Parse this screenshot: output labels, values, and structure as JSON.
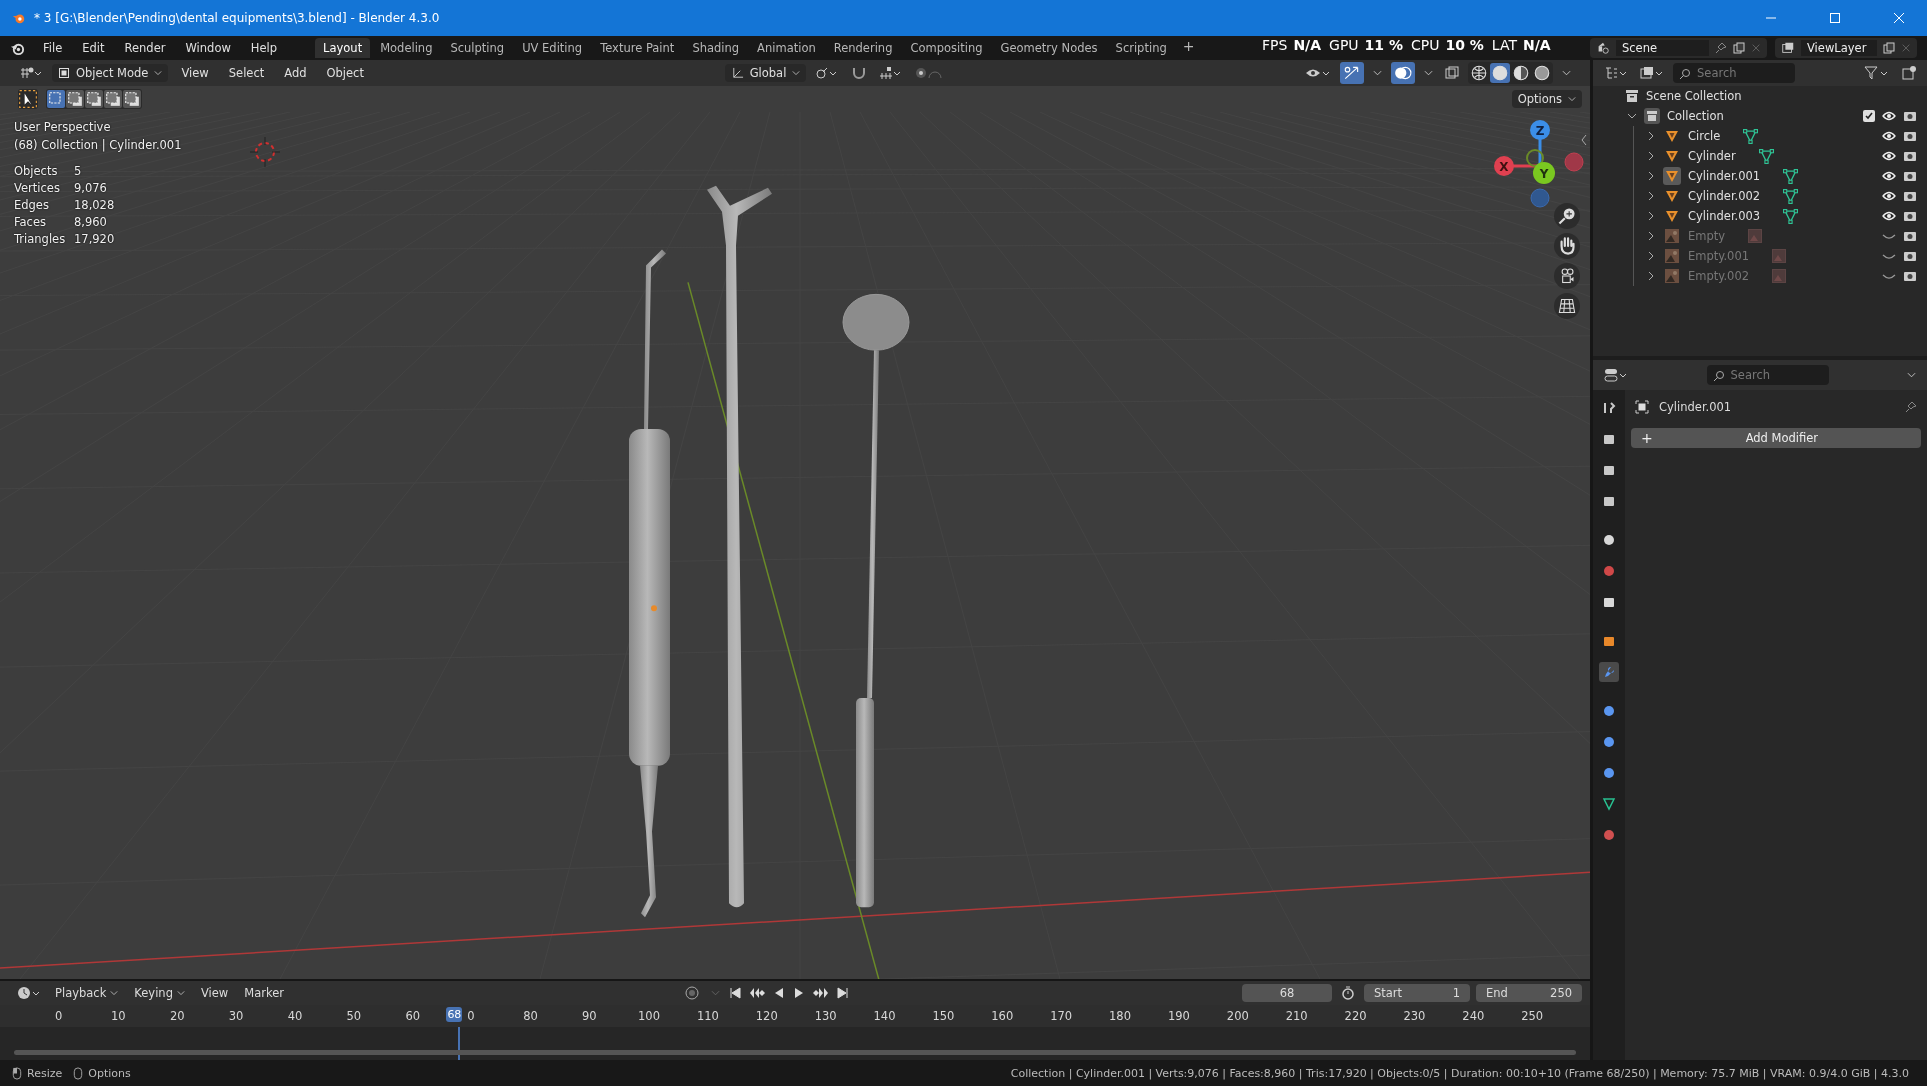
{
  "window": {
    "title": "* 3 [G:\\Blender\\Pending\\dental equipments\\3.blend] - Blender 4.3.0"
  },
  "menu": [
    "File",
    "Edit",
    "Render",
    "Window",
    "Help"
  ],
  "workspaces": [
    {
      "label": "Layout",
      "selected": true
    },
    {
      "label": "Modeling",
      "selected": false
    },
    {
      "label": "Sculpting",
      "selected": false
    },
    {
      "label": "UV Editing",
      "selected": false
    },
    {
      "label": "Texture Paint",
      "selected": false
    },
    {
      "label": "Shading",
      "selected": false
    },
    {
      "label": "Animation",
      "selected": false
    },
    {
      "label": "Rendering",
      "selected": false
    },
    {
      "label": "Compositing",
      "selected": false
    },
    {
      "label": "Geometry Nodes",
      "selected": false
    },
    {
      "label": "Scripting",
      "selected": false
    }
  ],
  "add_workspace": "+",
  "perf": [
    {
      "label": "FPS",
      "value": "N/A"
    },
    {
      "label": "GPU",
      "value": "11 %"
    },
    {
      "label": "CPU",
      "value": "10 %"
    },
    {
      "label": "LAT",
      "value": "N/A"
    }
  ],
  "scene": "Scene",
  "view_layer": "ViewLayer",
  "viewport": {
    "mode": "Object Mode",
    "menus": [
      "View",
      "Select",
      "Add",
      "Object"
    ],
    "orientation": "Global",
    "select_modes": [
      {
        "selected": true
      },
      {
        "selected": false
      },
      {
        "selected": false
      },
      {
        "selected": false
      },
      {
        "selected": false
      }
    ],
    "shading": [
      {
        "kind": "wireframe",
        "selected": false
      },
      {
        "kind": "solid",
        "selected": true
      },
      {
        "kind": "material",
        "selected": false
      },
      {
        "kind": "rendered",
        "selected": false
      }
    ],
    "options": "Options",
    "perspective": "User Perspective",
    "context": "(68) Collection | Cylinder.001",
    "stats": [
      {
        "label": "Objects",
        "value": "5"
      },
      {
        "label": "Vertices",
        "value": "9,076"
      },
      {
        "label": "Edges",
        "value": "18,028"
      },
      {
        "label": "Faces",
        "value": "8,960"
      },
      {
        "label": "Triangles",
        "value": "17,920"
      }
    ],
    "gizmo": {
      "x": "X",
      "y": "Y",
      "z": "Z"
    }
  },
  "outliner": {
    "search": {
      "placeholder": "Search"
    },
    "root": "Scene Collection",
    "collections": [
      {
        "name": "Collection",
        "expanded": true,
        "checked": true,
        "children": [
          {
            "name": "Circle",
            "kind": "mesh",
            "selected": false,
            "visible": true
          },
          {
            "name": "Cylinder",
            "kind": "mesh",
            "selected": false,
            "visible": true
          },
          {
            "name": "Cylinder.001",
            "kind": "mesh",
            "selected": true,
            "visible": true
          },
          {
            "name": "Cylinder.002",
            "kind": "mesh",
            "selected": false,
            "visible": true
          },
          {
            "name": "Cylinder.003",
            "kind": "mesh",
            "selected": false,
            "visible": true
          },
          {
            "name": "Empty",
            "kind": "image",
            "selected": false,
            "visible": false
          },
          {
            "name": "Empty.001",
            "kind": "image",
            "selected": false,
            "visible": false
          },
          {
            "name": "Empty.002",
            "kind": "image",
            "selected": false,
            "visible": false
          }
        ]
      }
    ]
  },
  "properties": {
    "search": {
      "placeholder": "Search"
    },
    "object": "Cylinder.001",
    "add_icon": "+",
    "add_modifier": "Add Modifier",
    "tabs": [
      {
        "kind": "tool",
        "selected": false
      },
      {
        "kind": "render",
        "selected": false
      },
      {
        "kind": "output",
        "selected": false
      },
      {
        "kind": "view_layer",
        "selected": false
      },
      {
        "kind": "scene",
        "selected": false
      },
      {
        "kind": "world",
        "selected": false
      },
      {
        "kind": "collection",
        "selected": false
      },
      {
        "kind": "object",
        "selected": false
      },
      {
        "kind": "modifiers",
        "selected": true
      },
      {
        "kind": "particles",
        "selected": false
      },
      {
        "kind": "physics",
        "selected": false
      },
      {
        "kind": "constraints",
        "selected": false
      },
      {
        "kind": "data",
        "selected": false
      },
      {
        "kind": "material",
        "selected": false
      }
    ]
  },
  "timeline": {
    "menus": [
      "Playback",
      "Keying",
      "View",
      "Marker"
    ],
    "current_frame": "68",
    "start_label": "Start",
    "start": "1",
    "end_label": "End",
    "end": "250",
    "ruler": [
      "0",
      "10",
      "20",
      "30",
      "40",
      "50",
      "60",
      "0",
      "80",
      "90",
      "100",
      "110",
      "120",
      "130",
      "140",
      "150",
      "160",
      "170",
      "180",
      "190",
      "200",
      "210",
      "220",
      "230",
      "240",
      "250"
    ],
    "playhead": "68"
  },
  "status": {
    "left": [
      "Resize",
      "Options"
    ],
    "right": "Collection | Cylinder.001 | Verts:9,076 | Faces:8,960 | Tris:17,920 | Objects:0/5 | Duration: 00:10+10 (Frame 68/250) | Memory: 75.7 MiB | VRAM: 0.9/4.0 GiB | 4.3.0"
  }
}
